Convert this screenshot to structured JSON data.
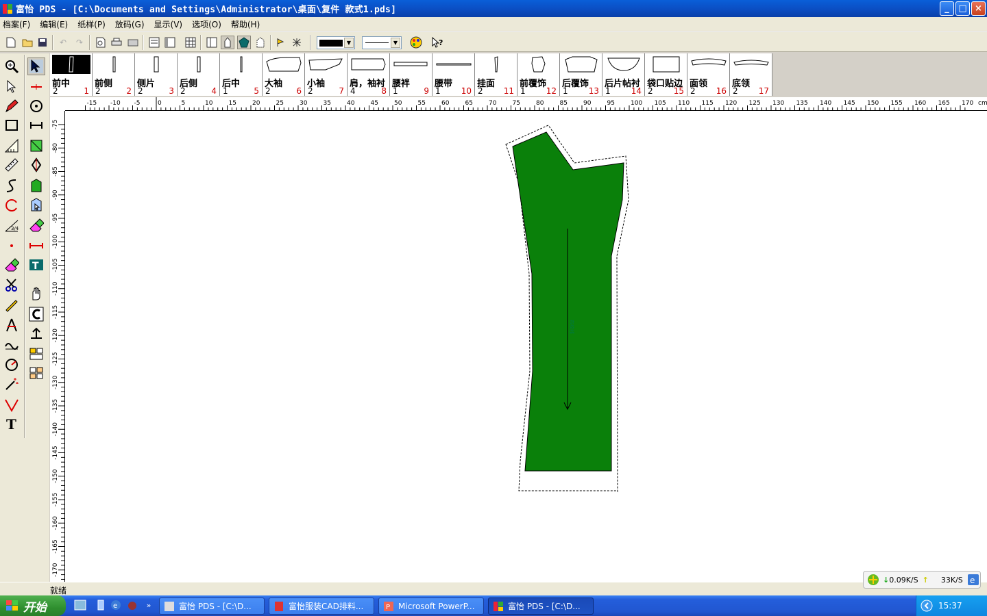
{
  "window": {
    "title": "富怡 PDS - [C:\\Documents and Settings\\Administrator\\桌面\\复件 款式1.pds]",
    "minimize": "_",
    "maximize": "□",
    "close": "×"
  },
  "menu": {
    "items": [
      "档案(F)",
      "编辑(E)",
      "纸样(P)",
      "放码(G)",
      "显示(V)",
      "选项(O)",
      "帮助(H)"
    ]
  },
  "pieces": [
    {
      "name": "前中",
      "count": "2",
      "num": "1"
    },
    {
      "name": "前侧",
      "count": "2",
      "num": "2"
    },
    {
      "name": "侧片",
      "count": "2",
      "num": "3"
    },
    {
      "name": "后侧",
      "count": "2",
      "num": "4"
    },
    {
      "name": "后中",
      "count": "1",
      "num": "5"
    },
    {
      "name": "大袖",
      "count": "2",
      "num": "6"
    },
    {
      "name": "小袖",
      "count": "2",
      "num": "7"
    },
    {
      "name": "肩，袖衬",
      "count": "4",
      "num": "8"
    },
    {
      "name": "腰袢",
      "count": "1",
      "num": "9"
    },
    {
      "name": "腰带",
      "count": "1",
      "num": "10"
    },
    {
      "name": "挂面",
      "count": "2",
      "num": "11"
    },
    {
      "name": "前覆饰",
      "count": "1",
      "num": "12"
    },
    {
      "name": "后覆饰",
      "count": "1",
      "num": "13"
    },
    {
      "name": "后片帖衬",
      "count": "1",
      "num": "14"
    },
    {
      "name": "袋口贴边",
      "count": "2",
      "num": "15"
    },
    {
      "name": "面领",
      "count": "2",
      "num": "16"
    },
    {
      "name": "底领",
      "count": "2",
      "num": "17"
    }
  ],
  "ruler": {
    "h_ticks": [
      "-15",
      "-10",
      "-5",
      "0",
      "5",
      "10",
      "15",
      "20",
      "25",
      "30",
      "35",
      "40",
      "45",
      "50",
      "55",
      "60",
      "65",
      "70",
      "75",
      "80",
      "85",
      "90",
      "95",
      "100",
      "105",
      "110",
      "115",
      "120",
      "125",
      "130",
      "135",
      "140",
      "145",
      "150",
      "155",
      "160",
      "165",
      "170"
    ],
    "h_unit": "cm",
    "v_ticks": [
      "-75",
      "-80",
      "-85",
      "-90",
      "-95",
      "-100",
      "-105",
      "-110",
      "-115",
      "-120",
      "-125",
      "-130",
      "-135",
      "-140",
      "-145",
      "-150",
      "-155",
      "-160",
      "-165",
      "-170"
    ]
  },
  "canvas": {
    "piece_fill": "#0a800a",
    "grain_label": "布纹线"
  },
  "status": {
    "text": "就绪"
  },
  "netmon": {
    "down": "0.09K/S",
    "up": "33K/S"
  },
  "taskbar": {
    "start": "开始",
    "tasks": [
      {
        "label": "富怡 PDS - [C:\\D..."
      },
      {
        "label": "富怡服装CAD排料..."
      },
      {
        "label": "Microsoft PowerP..."
      },
      {
        "label": "富怡 PDS - [C:\\D..."
      }
    ],
    "clock": "15:37"
  }
}
